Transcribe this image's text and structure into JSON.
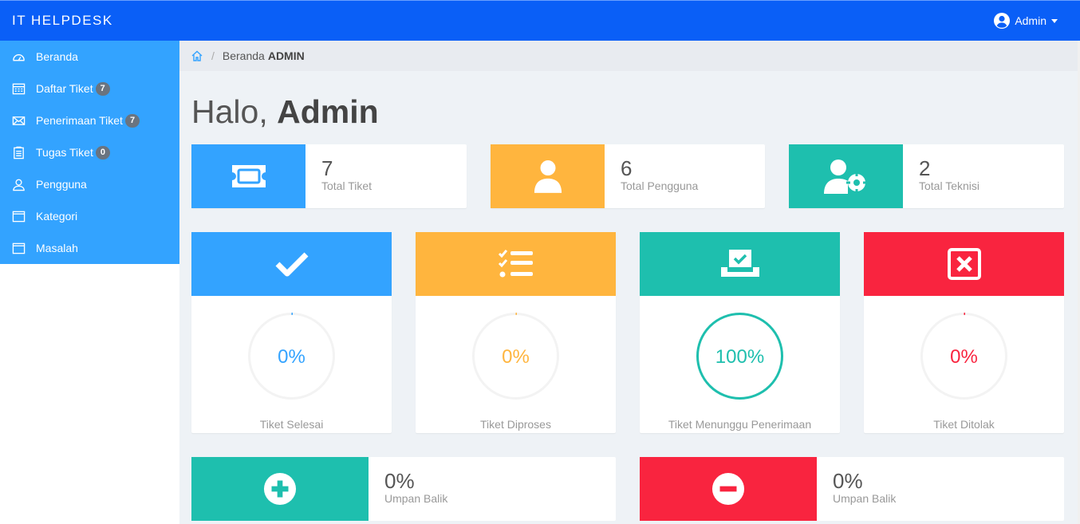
{
  "app": {
    "brand": "IT HELPDESK",
    "user": "Admin"
  },
  "colors": {
    "primary": "#33a3ff",
    "navbar": "#0a5ff7",
    "warning": "#ffb53e",
    "success": "#1ebfae",
    "danger": "#f9243f"
  },
  "sidebar": {
    "items": [
      {
        "label": "Beranda",
        "icon": "dashboard-icon"
      },
      {
        "label": "Daftar Tiket",
        "icon": "calendar-icon",
        "badge": "7"
      },
      {
        "label": "Penerimaan Tiket",
        "icon": "envelope-icon",
        "badge": "7"
      },
      {
        "label": "Tugas Tiket",
        "icon": "clipboard-icon",
        "badge": "0"
      },
      {
        "label": "Pengguna",
        "icon": "user-icon"
      },
      {
        "label": "Kategori",
        "icon": "window-icon"
      },
      {
        "label": "Masalah",
        "icon": "window-icon"
      }
    ]
  },
  "breadcrumb": {
    "page": "Beranda",
    "role": "ADMIN"
  },
  "greeting": {
    "prefix": "Halo,",
    "name": "Admin"
  },
  "stats": [
    {
      "value": "7",
      "label": "Total Tiket",
      "icon": "ticket-icon"
    },
    {
      "value": "6",
      "label": "Total Pengguna",
      "icon": "user-icon"
    },
    {
      "value": "2",
      "label": "Total Teknisi",
      "icon": "user-gear-icon"
    }
  ],
  "progress": [
    {
      "value": "0%",
      "fraction": 0,
      "label": "Tiket Selesai",
      "icon": "check-icon"
    },
    {
      "value": "0%",
      "fraction": 0,
      "label": "Tiket Diproses",
      "icon": "checklist-icon"
    },
    {
      "value": "100%",
      "fraction": 1,
      "label": "Tiket Menunggu Penerimaan",
      "icon": "ballot-box-icon"
    },
    {
      "value": "0%",
      "fraction": 0,
      "label": "Tiket Ditolak",
      "icon": "x-square-icon"
    }
  ],
  "feedback": [
    {
      "value": "0%",
      "label": "Umpan Balik",
      "icon": "plus-circle-icon"
    },
    {
      "value": "0%",
      "label": "Umpan Balik",
      "icon": "minus-circle-icon"
    }
  ]
}
